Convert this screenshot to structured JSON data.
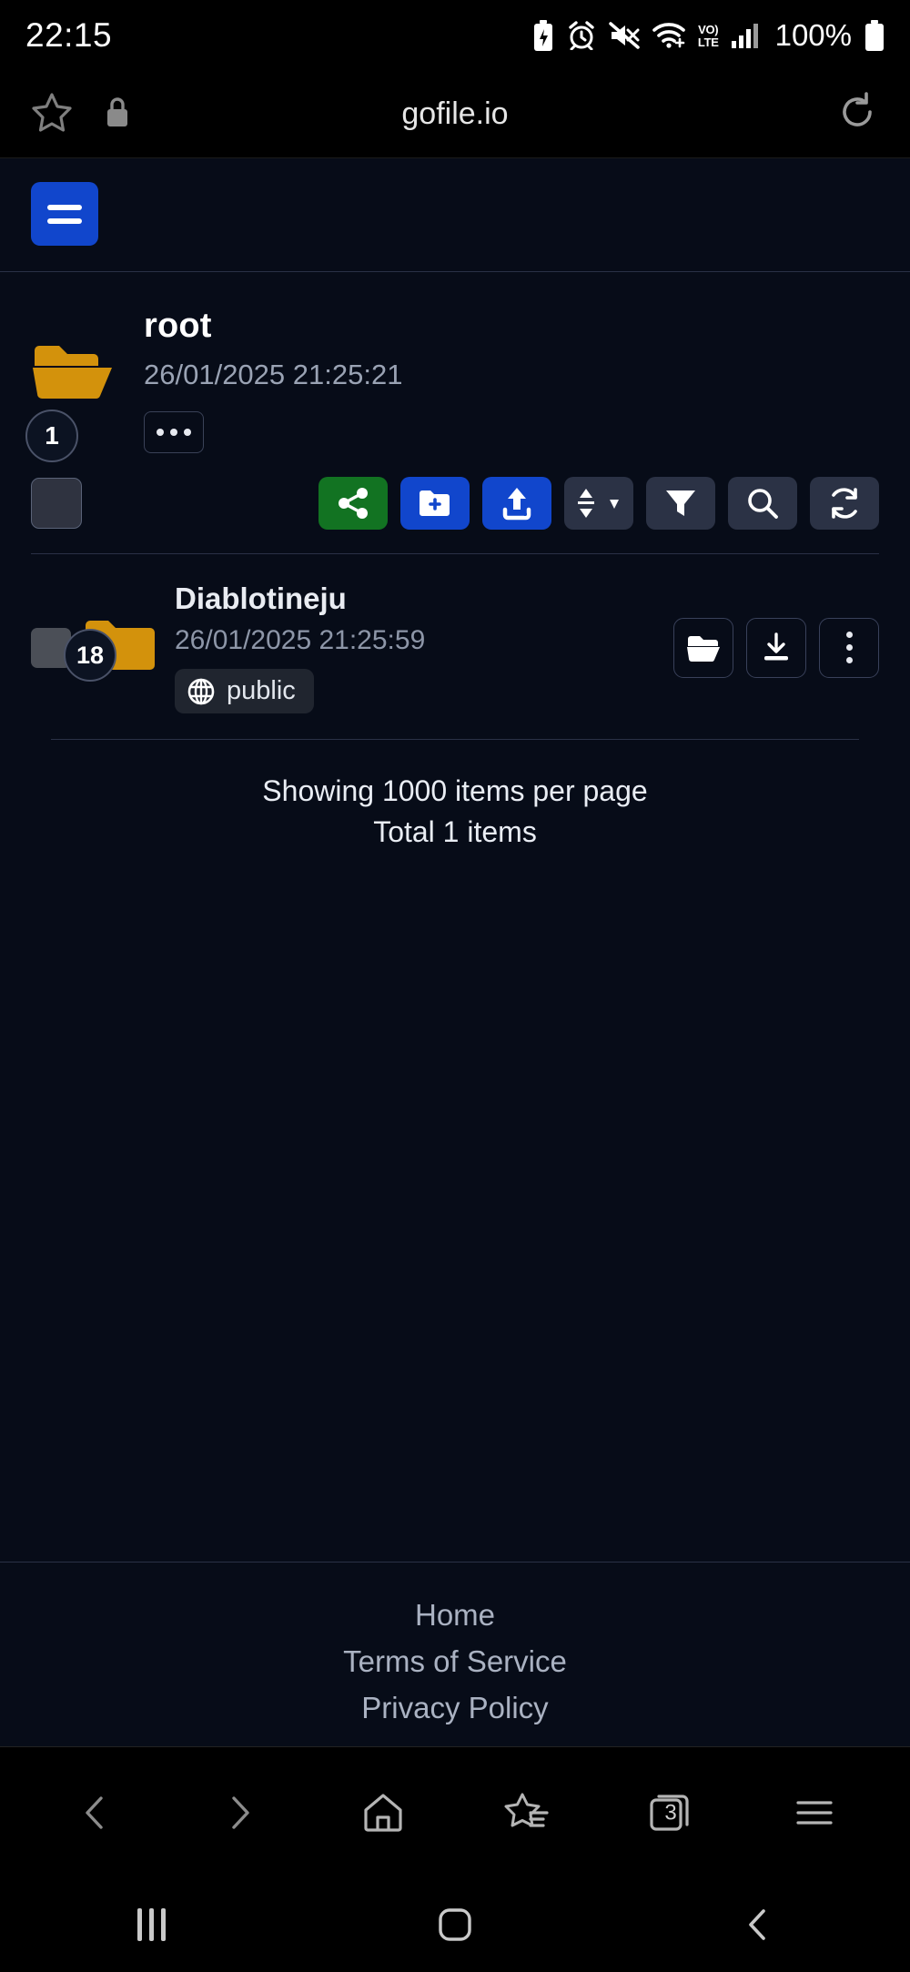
{
  "status_bar": {
    "time": "22:15",
    "battery_percent": "100%",
    "volte_line1": "VO)",
    "volte_line2": "LTE",
    "icons": [
      "battery-saver-icon",
      "alarm-icon",
      "mute-icon",
      "wifi-icon",
      "volte-icon",
      "signal-bars-icon",
      "battery-icon"
    ]
  },
  "browser": {
    "url": "gofile.io",
    "bookmark_icon": "star-icon",
    "lock_icon": "lock-icon",
    "reload_icon": "reload-icon",
    "nav": {
      "back": "chevron-left-icon",
      "forward": "chevron-right-icon",
      "home": "home-icon",
      "bookmarks": "star-list-icon",
      "tabs_count": "3",
      "menu": "hamburger-icon"
    }
  },
  "app": {
    "menu_button_label": "menu",
    "root": {
      "name": "root",
      "date": "26/01/2025 21:25:21",
      "badge_count": "1",
      "more_label": "..."
    },
    "toolbar": {
      "select_all_label": "select all",
      "buttons": [
        {
          "name": "share",
          "icon": "share-icon",
          "color": "#127322"
        },
        {
          "name": "new-folder",
          "icon": "folder-plus-icon",
          "color": "#1146cc"
        },
        {
          "name": "upload",
          "icon": "upload-icon",
          "color": "#1146cc"
        },
        {
          "name": "sort",
          "icon": "sort-icon",
          "color": "#2b3245"
        },
        {
          "name": "filter",
          "icon": "filter-icon",
          "color": "#2b3245"
        },
        {
          "name": "search",
          "icon": "search-icon",
          "color": "#2b3245"
        },
        {
          "name": "refresh",
          "icon": "refresh-icon",
          "color": "#2b3245"
        }
      ]
    },
    "items": [
      {
        "name": "Diablotineju",
        "date": "26/01/2025 21:25:59",
        "badge_count": "18",
        "visibility": "public",
        "visibility_icon": "globe-icon",
        "actions": [
          "open-folder-icon",
          "download-icon",
          "kebab-icon"
        ]
      }
    ],
    "pagination": {
      "showing": "Showing 1000 items per page",
      "total": "Total 1 items"
    },
    "footer_links": [
      {
        "label": "Home"
      },
      {
        "label": "Terms of Service"
      },
      {
        "label": "Privacy Policy"
      }
    ]
  },
  "colors": {
    "background": "#070c18",
    "accent_blue": "#1146cc",
    "accent_green": "#127322",
    "folder_amber": "#d3920c",
    "divider": "#2a3146",
    "muted_text": "#9aa3b4"
  }
}
